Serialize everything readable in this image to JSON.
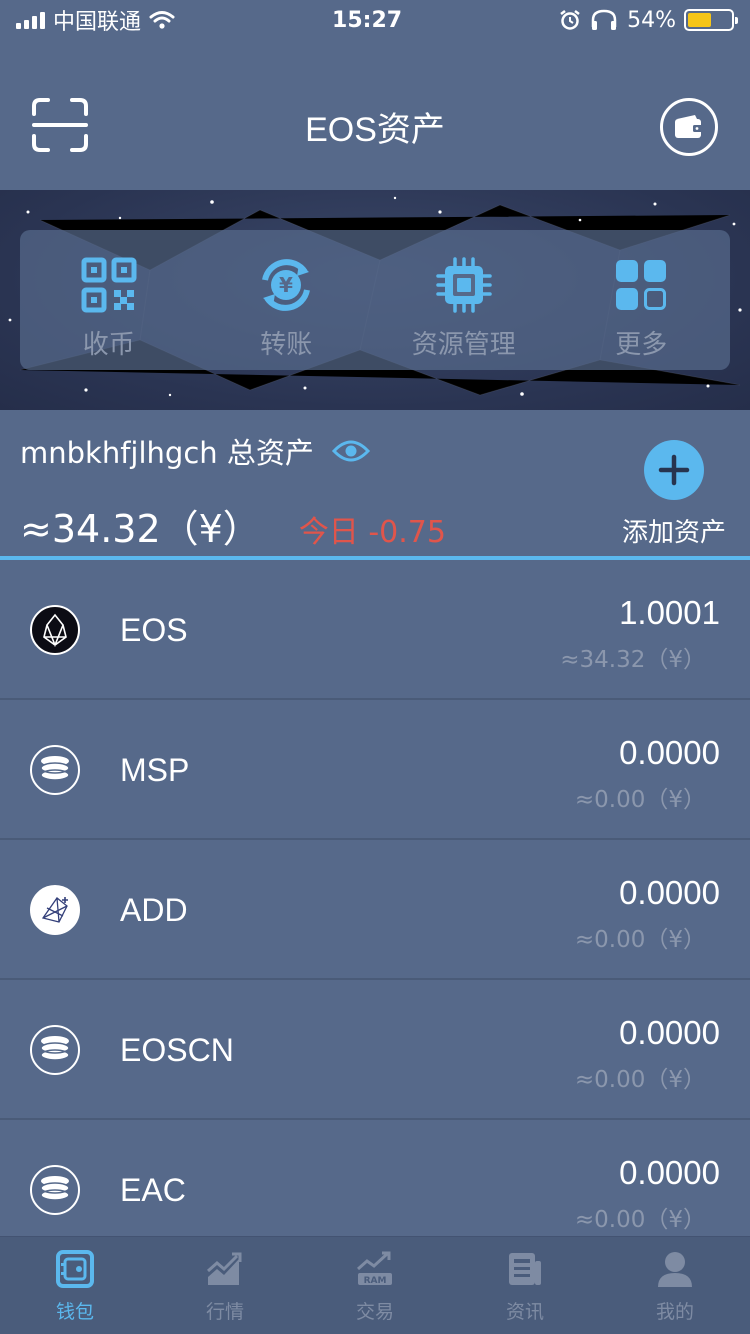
{
  "status_bar": {
    "carrier": "中国联通",
    "time": "15:27",
    "battery": "54%"
  },
  "header": {
    "title": "EOS资产"
  },
  "actions": [
    {
      "label": "收币",
      "icon": "qr-code-icon"
    },
    {
      "label": "转账",
      "icon": "transfer-yuan-icon"
    },
    {
      "label": "资源管理",
      "icon": "chip-icon"
    },
    {
      "label": "更多",
      "icon": "grid-icon"
    }
  ],
  "summary": {
    "account": "mnbkhfjlhgch",
    "total_label": "总资产",
    "total_value": "≈34.32（¥）",
    "today": "今日 -0.75",
    "add_asset_label": "添加资产"
  },
  "tokens": [
    {
      "name": "EOS",
      "amount": "1.0001",
      "fiat": "≈34.32（¥）",
      "icon": "eos-logo-icon"
    },
    {
      "name": "MSP",
      "amount": "0.0000",
      "fiat": "≈0.00（¥）",
      "icon": "coin-stack-icon"
    },
    {
      "name": "ADD",
      "amount": "0.0000",
      "fiat": "≈0.00（¥）",
      "icon": "add-token-icon"
    },
    {
      "name": "EOSCN",
      "amount": "0.0000",
      "fiat": "≈0.00（¥）",
      "icon": "coin-stack-icon"
    },
    {
      "name": "EAC",
      "amount": "0.0000",
      "fiat": "≈0.00（¥）",
      "icon": "coin-stack-icon"
    }
  ],
  "tabs": [
    {
      "label": "钱包",
      "icon": "wallet-safe-icon",
      "active": true
    },
    {
      "label": "行情",
      "icon": "market-chart-icon",
      "active": false
    },
    {
      "label": "交易",
      "icon": "ram-trade-icon",
      "active": false
    },
    {
      "label": "资讯",
      "icon": "news-icon",
      "active": false
    },
    {
      "label": "我的",
      "icon": "profile-icon",
      "active": false
    }
  ],
  "colors": {
    "background": "#56698a",
    "accent": "#5bb8ee",
    "negative": "#e0554b",
    "muted": "#8b97ad"
  }
}
